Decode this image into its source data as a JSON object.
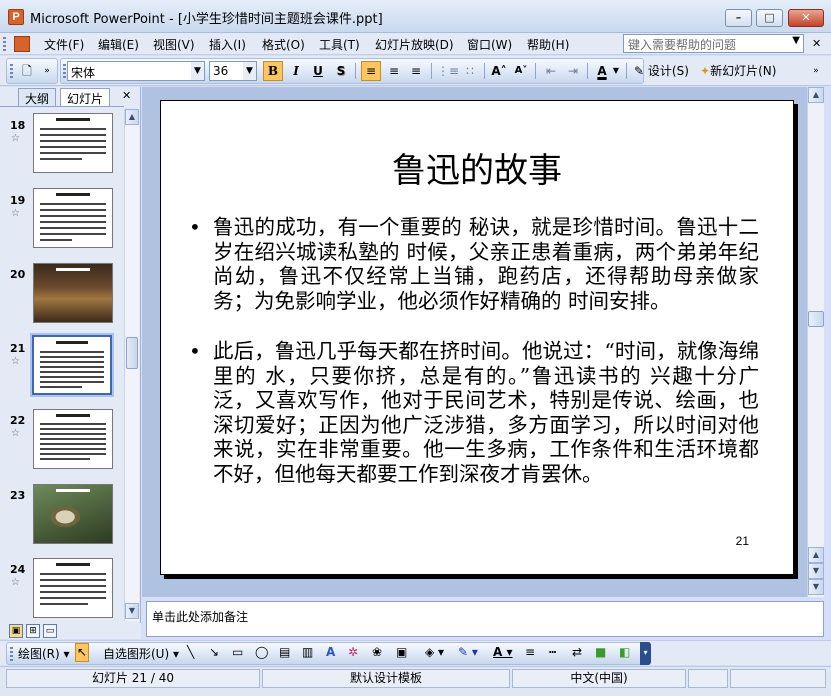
{
  "window": {
    "app_name": "Microsoft PowerPoint",
    "title": "Microsoft PowerPoint - [小学生珍惜时间主题班会课件.ppt]",
    "controls": {
      "minimize": "–",
      "maximize": "□",
      "close": "✕"
    }
  },
  "menu": {
    "items": [
      "文件(F)",
      "编辑(E)",
      "视图(V)",
      "插入(I)",
      "格式(O)",
      "工具(T)",
      "幻灯片放映(D)",
      "窗口(W)",
      "帮助(H)"
    ],
    "help_box_placeholder": "键入需要帮助的问题"
  },
  "format_toolbar": {
    "font_name": "宋体",
    "font_size": "36",
    "bold": "B",
    "italic": "I",
    "underline": "U",
    "shadow": "S",
    "design_label": "设计(S)",
    "new_slide_label": "新幻灯片(N)",
    "font_color_letter": "A"
  },
  "left_panel": {
    "tabs": [
      "大纲",
      "幻灯片"
    ],
    "active_tab": "幻灯片",
    "close_glyph": "✕",
    "thumbnails": [
      {
        "number": "18",
        "kind": "text",
        "selected": false
      },
      {
        "number": "19",
        "kind": "text",
        "selected": false
      },
      {
        "number": "20",
        "kind": "photo-room",
        "selected": false
      },
      {
        "number": "21",
        "kind": "text",
        "selected": true
      },
      {
        "number": "22",
        "kind": "text",
        "selected": false
      },
      {
        "number": "23",
        "kind": "photo-bird",
        "selected": false
      },
      {
        "number": "24",
        "kind": "text",
        "selected": false
      }
    ],
    "star_glyph": "☆"
  },
  "slide": {
    "title": "鲁迅的故事",
    "bullet_glyph": "•",
    "bullets": [
      "鲁迅的成功，有一个重要的 秘诀，就是珍惜时间。鲁迅十二岁在绍兴城读私塾的 时候，父亲正患着重病，两个弟弟年纪尚幼，鲁迅不仅经常上当铺，跑药店，还得帮助母亲做家务；为免影响学业，他必须作好精确的 时间安排。",
      "此后，鲁迅几乎每天都在挤时间。他说过：“时间，就像海绵里的 水，只要你挤，总是有的。”鲁迅读书的 兴趣十分广泛，又喜欢写作，他对于民间艺术，特别是传说、绘画，也深切爱好；正因为他广泛涉猎，多方面学习，所以时间对他来说，实在非常重要。他一生多病，工作条件和生活环境都不好，但他每天都要工作到深夜才肯罢休。"
    ],
    "number": "21"
  },
  "notes": {
    "placeholder": "单击此处添加备注"
  },
  "draw_toolbar": {
    "draw_label": "绘图(R)",
    "autoshape_label": "自选图形(U)"
  },
  "status_bar": {
    "slide_info": "幻灯片 21 / 40",
    "template": "默认设计模板",
    "language": "中文(中国)"
  },
  "colors": {
    "accent": "#3f66ae",
    "toolbar_bg": "#e3eaf6",
    "edit_area_bg": "#afc2e2",
    "active_button": "#ffc660"
  }
}
